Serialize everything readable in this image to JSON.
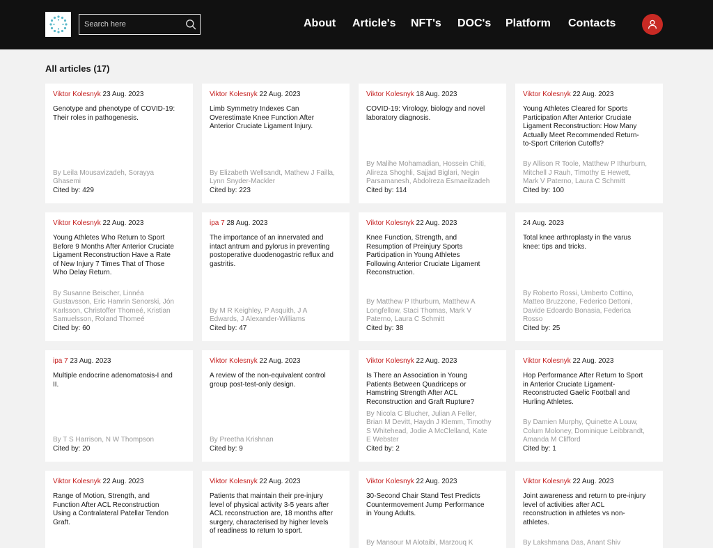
{
  "header": {
    "search_placeholder": "Search here",
    "nav": [
      "About",
      "Article's",
      "NFT's",
      "DOC's",
      "Platform",
      "Contacts"
    ]
  },
  "page": {
    "heading": "All articles (17)"
  },
  "cited_prefix": "Cited by: ",
  "articles": [
    {
      "author": "Viktor Kolesnyk",
      "date": "23 Aug. 2023",
      "title": "Genotype and phenotype of COVID-19: Their roles in pathogenesis.",
      "authors": "By Leila Mousavizadeh, Sorayya Ghasemi",
      "cited": "429"
    },
    {
      "author": "Viktor Kolesnyk",
      "date": "22 Aug. 2023",
      "title": "Limb Symmetry Indexes Can Overestimate Knee Function After Anterior Cruciate Ligament Injury.",
      "authors": "By Elizabeth Wellsandt, Mathew J Failla, Lynn Snyder-Mackler",
      "cited": "223"
    },
    {
      "author": "Viktor Kolesnyk",
      "date": "18 Aug. 2023",
      "title": "COVID-19: Virology, biology and novel laboratory diagnosis.",
      "authors": "By Malihe Mohamadian, Hossein Chiti, Alireza Shoghli, Sajjad Biglari, Negin Parsamanesh, Abdolreza Esmaeilzadeh",
      "cited": "114"
    },
    {
      "author": "Viktor Kolesnyk",
      "date": "22 Aug. 2023",
      "title": "Young Athletes Cleared for Sports Participation After Anterior Cruciate Ligament Reconstruction: How Many Actually Meet Recommended Return-to-Sport Criterion Cutoffs?",
      "authors": "By Allison R Toole, Matthew P Ithurburn, Mitchell J Rauh, Timothy E Hewett, Mark V Paterno, Laura C Schmitt",
      "cited": "100"
    },
    {
      "author": "Viktor Kolesnyk",
      "date": "22 Aug. 2023",
      "title": "Young Athletes Who Return to Sport Before 9 Months After Anterior Cruciate Ligament Reconstruction Have a Rate of New Injury 7 Times That of Those Who Delay Return.",
      "authors": "By Susanne Beischer, Linnéa Gustavsson, Eric Hamrin Senorski, Jón Karlsson, Christoffer Thomeé, Kristian Samuelsson, Roland Thomeé",
      "cited": "60"
    },
    {
      "author": "ipa 7",
      "date": "28 Aug. 2023",
      "title": "The importance of an innervated and intact antrum and pylorus in preventing postoperative duodenogastric reflux and gastritis.",
      "authors": "By M R Keighley, P Asquith, J A Edwards, J Alexander-Williams",
      "cited": "47"
    },
    {
      "author": "Viktor Kolesnyk",
      "date": "22 Aug. 2023",
      "title": "Knee Function, Strength, and Resumption of Preinjury Sports Participation in Young Athletes Following Anterior Cruciate Ligament Reconstruction.",
      "authors": "By Matthew P Ithurburn, Matthew A Longfellow, Staci Thomas, Mark V Paterno, Laura C Schmitt",
      "cited": "38"
    },
    {
      "author": "",
      "date": "24 Aug. 2023",
      "title": "Total knee arthroplasty in the varus knee: tips and tricks.",
      "authors": "By Roberto Rossi, Umberto Cottino, Matteo Bruzzone, Federico Dettoni, Davide Edoardo Bonasia, Federica Rosso",
      "cited": "25"
    },
    {
      "author": "ipa 7",
      "date": "23 Aug. 2023",
      "title": "Multiple endocrine adenomatosis-I and II.",
      "authors": "By T S Harrison, N W Thompson",
      "cited": "20"
    },
    {
      "author": "Viktor Kolesnyk",
      "date": "22 Aug. 2023",
      "title": "A review of the non-equivalent control group post-test-only design.",
      "authors": "By Preetha Krishnan",
      "cited": "9"
    },
    {
      "author": "Viktor Kolesnyk",
      "date": "22 Aug. 2023",
      "title": "Is There an Association in Young Patients Between Quadriceps or Hamstring Strength After ACL Reconstruction and Graft Rupture?",
      "authors": "By Nicola C Blucher, Julian A Feller, Brian M Devitt, Haydn J Klemm, Timothy S Whitehead, Jodie A McClelland, Kate E Webster",
      "cited": "2"
    },
    {
      "author": "Viktor Kolesnyk",
      "date": "22 Aug. 2023",
      "title": "Hop Performance After Return to Sport in Anterior Cruciate Ligament-Reconstructed Gaelic Football and Hurling Athletes.",
      "authors": "By Damien Murphy, Quinette A Louw, Colum Moloney, Dominique Leibbrandt, Amanda M Clifford",
      "cited": "1"
    },
    {
      "author": "Viktor Kolesnyk",
      "date": "22 Aug. 2023",
      "title": "Range of Motion, Strength, and Function After ACL Reconstruction Using a Contralateral Patellar Tendon Graft.",
      "authors": "",
      "cited": ""
    },
    {
      "author": "Viktor Kolesnyk",
      "date": "22 Aug. 2023",
      "title": "Patients that maintain their pre-injury level of physical activity 3-5 years after ACL reconstruction are, 18 months after surgery, characterised by higher levels of readiness to return to sport.",
      "authors": "",
      "cited": ""
    },
    {
      "author": "Viktor Kolesnyk",
      "date": "22 Aug. 2023",
      "title": "30-Second Chair Stand Test Predicts Countermovement Jump Performance in Young Adults.",
      "authors": "By Mansour M Alotaibi, Marzouq K",
      "cited": ""
    },
    {
      "author": "Viktor Kolesnyk",
      "date": "22 Aug. 2023",
      "title": "Joint awareness and return to pre-injury level of activities after ACL reconstruction in athletes vs non-athletes.",
      "authors": "By Lakshmana Das, Anant Shiv",
      "cited": ""
    }
  ]
}
